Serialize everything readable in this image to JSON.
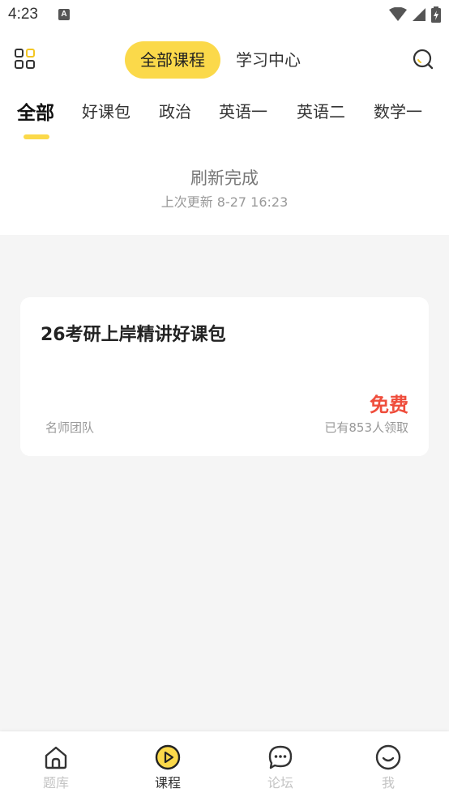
{
  "status_bar": {
    "time": "4:23",
    "app_icon_letter": "A"
  },
  "header": {
    "tabs": [
      {
        "label": "全部课程",
        "active": true
      },
      {
        "label": "学习中心",
        "active": false
      }
    ],
    "icons": {
      "left": "apps-grid-icon",
      "right": "search-icon"
    }
  },
  "categories": [
    {
      "label": "全部",
      "active": true
    },
    {
      "label": "好课包"
    },
    {
      "label": "政治"
    },
    {
      "label": "英语一"
    },
    {
      "label": "英语二"
    },
    {
      "label": "数学一"
    }
  ],
  "refresh": {
    "title": "刷新完成",
    "last_update": "上次更新 8-27 16:23"
  },
  "course": {
    "title": "26考研上岸精讲好课包",
    "price": "免费",
    "teacher": "名师团队",
    "enrolled": "已有853人领取"
  },
  "bottom_nav": [
    {
      "label": "题库",
      "icon": "home-icon",
      "active": false
    },
    {
      "label": "课程",
      "icon": "play-circle-icon",
      "active": true
    },
    {
      "label": "论坛",
      "icon": "chat-bubble-icon",
      "active": false
    },
    {
      "label": "我",
      "icon": "smiley-icon",
      "active": false
    }
  ],
  "colors": {
    "accent": "#fbd94a",
    "price": "#ef4d3c",
    "background": "#f5f5f5"
  }
}
